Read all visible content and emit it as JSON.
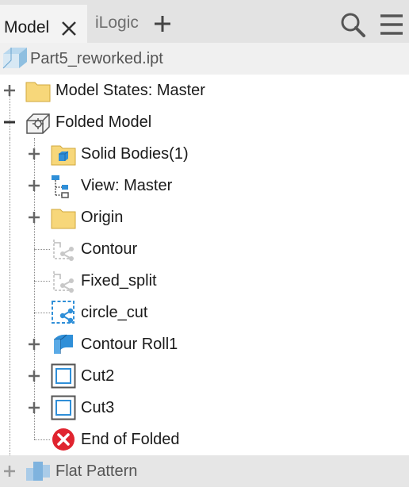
{
  "tabs": {
    "model_label": "Model",
    "ilogic_label": "iLogic"
  },
  "toolbar": {
    "search_icon": "search-icon",
    "menu_icon": "hamburger-menu-icon"
  },
  "file": {
    "name": "Part5_reworked.ipt"
  },
  "tree": {
    "model_states": "Model States: Master",
    "folded_model": "Folded Model",
    "solid_bodies": "Solid Bodies(1)",
    "view": "View: Master",
    "origin": "Origin",
    "contour": "Contour",
    "fixed_split": "Fixed_split",
    "circle_cut": "circle_cut",
    "contour_roll": "Contour Roll1",
    "cut2": "Cut2",
    "cut3": "Cut3",
    "end_of_folded": "End of Folded",
    "flat_pattern": "Flat Pattern"
  },
  "colors": {
    "folder": "#f7d77a",
    "accent_blue": "#2f8fd8",
    "error_red": "#e0242f"
  }
}
